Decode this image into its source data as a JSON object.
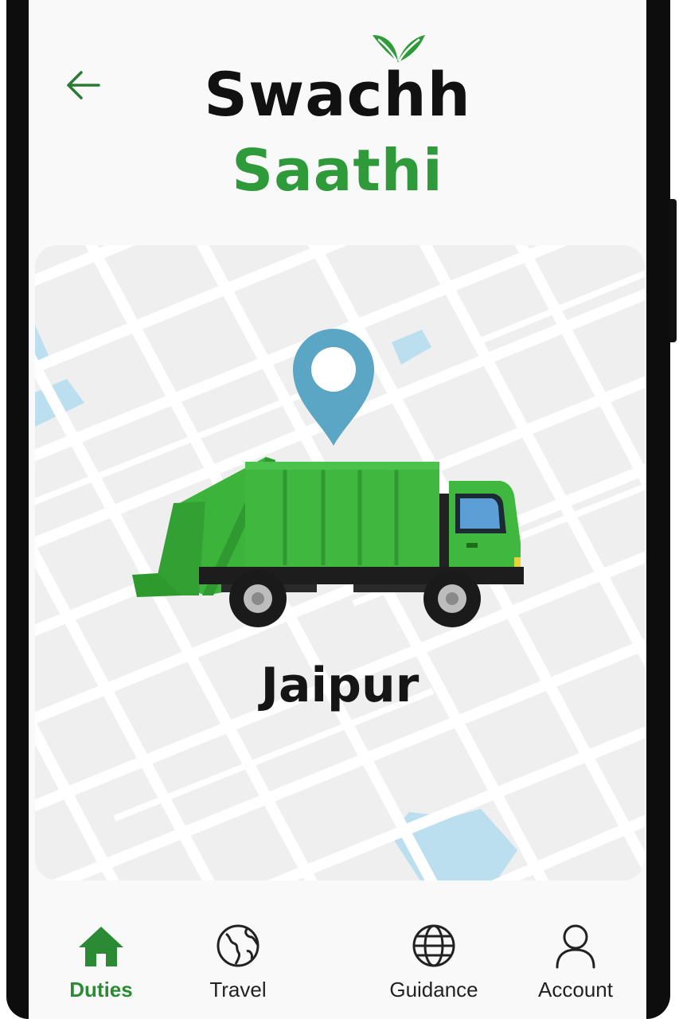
{
  "app": {
    "title_line1": "Swachh",
    "title_line2": "Saathi",
    "brand_color": "#2f9a3a"
  },
  "header": {
    "back_icon": "arrow-left-icon"
  },
  "map": {
    "city": "Jaipur",
    "pin_color": "#5aa6c4",
    "truck_color": "#3cb43c"
  },
  "nav": {
    "items": [
      {
        "label": "Duties",
        "icon": "home-icon",
        "active": true
      },
      {
        "label": "Travel",
        "icon": "globe-icon",
        "active": false
      },
      {
        "label": "Guidance",
        "icon": "globe-grid-icon",
        "active": false
      },
      {
        "label": "Account",
        "icon": "user-icon",
        "active": false
      }
    ]
  }
}
